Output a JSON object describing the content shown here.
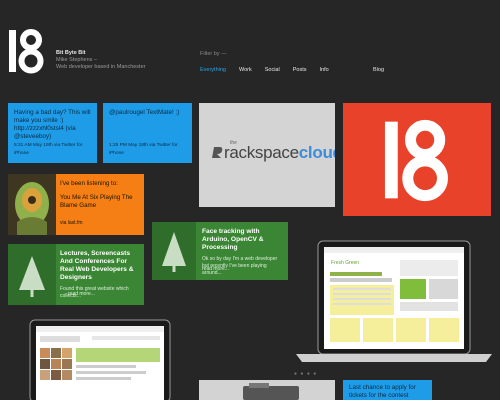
{
  "brand": {
    "title": "Bit Byte Bit",
    "name": "Mike Stephens –",
    "tagline": "Web developer based in Manchester"
  },
  "filter": {
    "label": "Filter by —",
    "items": [
      "Everything",
      "Work",
      "Social",
      "Posts",
      "Info"
    ],
    "active": "Everything"
  },
  "blog_label": "Blog",
  "tweets": [
    {
      "text": "Having a bad day? This will make you smile :) http://zzzxhl0stsl4 (via @steveeboy)",
      "meta": "5:31 AM May 19th via Twitter for iPhone"
    },
    {
      "text": "@paulrougel TextMate! ;)",
      "meta": "1:25 PM May 18th via Twitter for iPhone"
    }
  ],
  "listening": {
    "intro": "I've been listening to:",
    "track": "You Me At Six Playing The Blame Game",
    "via": "via last.fm"
  },
  "posts": [
    {
      "title": "Face tracking with Arduino, OpenCV & Processing",
      "body": "Ok so by day I'm a web developer but recently I've been playing around...",
      "more": "read more..."
    },
    {
      "title": "Lectures, Screencasts And Conferences For Real Web Developers & Designers",
      "body": "Found this great website which collects...",
      "more": "read more..."
    }
  ],
  "sponsor": {
    "prefix": "the",
    "word_a": "rackspace",
    "word_b": "cloud"
  },
  "laptop_site_title": "Fresh Green",
  "bottom_tweet": "Last chance to apply for tickets for the contest between @thenoof #l and",
  "pager": "● ● ● ●"
}
